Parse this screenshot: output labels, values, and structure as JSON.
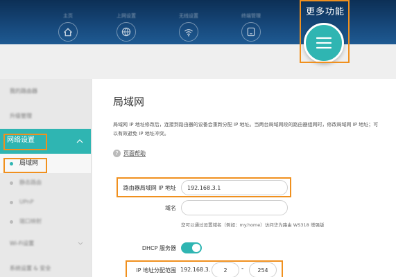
{
  "header": {
    "more_label": "更多功能",
    "nav_items": [
      {
        "label": "主页",
        "icon": "home-icon"
      },
      {
        "label": "上网设置",
        "icon": "globe-icon"
      },
      {
        "label": "无线设置",
        "icon": "wifi-icon"
      },
      {
        "label": "终端管理",
        "icon": "devices-icon"
      }
    ],
    "more_icon": "menu-icon"
  },
  "sidebar": {
    "top_items": [
      "我的路由器",
      "升级管理"
    ],
    "active_group": "网络设置",
    "sub_items": [
      {
        "label": "局域网",
        "current": true
      },
      {
        "label": "静态路由",
        "current": false
      },
      {
        "label": "UPnP",
        "current": false
      },
      {
        "label": "端口映射",
        "current": false
      }
    ],
    "bottom_items": [
      "Wi-Fi设置",
      "系统设置 & 安全"
    ]
  },
  "main": {
    "title": "局域网",
    "description": "局域网 IP 地址修改后，连接到路由器的设备会重新分配 IP 地址。当两台局域网段的路由器组网时，修改局域网 IP 地址；可以有效避免 IP 地址冲突。",
    "help_label": "页面帮助",
    "router_ip_label": "路由器局域网 IP 地址",
    "router_ip_value": "192.168.3.1",
    "domain_label": "域名",
    "domain_value": "",
    "domain_hint": "您可以通过设置域名（例如：my.home）访问华为路由 WS318 增强版",
    "dhcp_label": "DHCP 服务器",
    "dhcp_on": true,
    "range_label": "IP 地址分配范围",
    "range_prefix": "192.168.3.",
    "range_start": "2",
    "range_sep": "-",
    "range_end": "254"
  },
  "colors": {
    "accent": "#2fb5b2",
    "highlight": "#f0901e",
    "header": "#17497c"
  }
}
